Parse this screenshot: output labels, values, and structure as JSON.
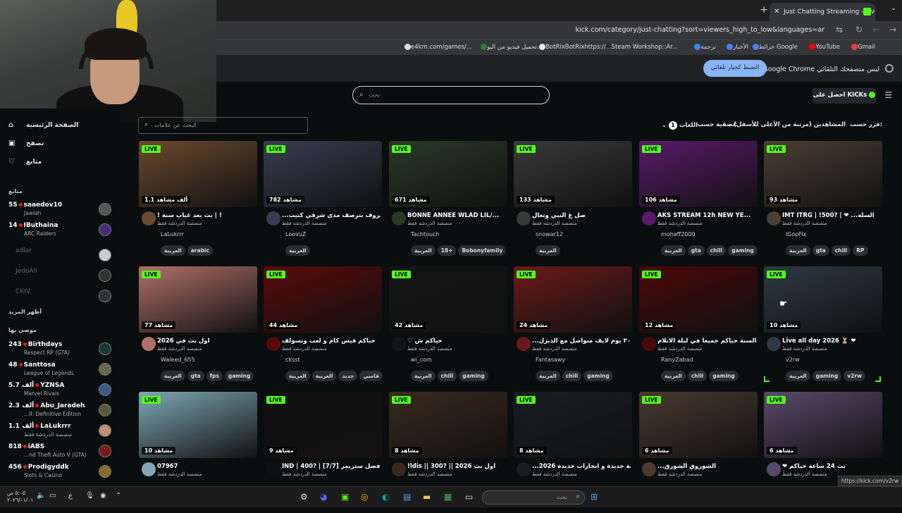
{
  "browser": {
    "tab_title": "Just Chatting Streaming - Live",
    "url": "kick.com/category/just-chatting?sort=viewers_high_to_low&languages=ar",
    "bookmarks": [
      "Gmail",
      "YouTube",
      "خرائط Google",
      "الأخبار",
      "ترجمة",
      "Steam Workshop::Ar...",
      "BotRixBotRixhttps://...",
      "تحميل فيديو من اليو...",
      "e4km.com/games/..."
    ],
    "info_text": "Google Chrome ليس متصفحك التلقائي",
    "info_button": "الضبط كخيار تلقائي"
  },
  "header": {
    "search_placeholder": "بحث",
    "get_kicks": "احصل على KICKs"
  },
  "sidebar": {
    "nav": [
      {
        "label": "الصفحة الرئيسية",
        "icon": "home-icon"
      },
      {
        "label": "تصفح",
        "icon": "browse-icon"
      },
      {
        "label": "متابع",
        "icon": "heart-icon"
      }
    ],
    "following_heading": "متابع",
    "following": [
      {
        "viewers": "55",
        "name": "saaedov10",
        "sub": "Jawlah",
        "live": true
      },
      {
        "viewers": "14",
        "name": "IButhaina",
        "sub": "ARC Raiders",
        "live": true
      },
      {
        "viewers": "",
        "name": "adlar",
        "sub": "",
        "live": false
      },
      {
        "viewers": "",
        "name": "JedoAli",
        "sub": "",
        "live": false
      },
      {
        "viewers": "",
        "name": "CKIV",
        "sub": "",
        "live": false
      }
    ],
    "show_more": "أظهر المزيد",
    "recommended_heading": "موصى بها",
    "recommended": [
      {
        "viewers": "243",
        "name": "Birthdays",
        "sub": "Respect RP (GTA)"
      },
      {
        "viewers": "48",
        "name": "Santtosa",
        "sub": "League of Legends"
      },
      {
        "viewers": "5.7 ألف",
        "name": "YZNSA",
        "sub": "Marvel Rivals"
      },
      {
        "viewers": "2.3 ألف",
        "name": "Abu_Jaradeh",
        "sub": "...II: Definitive Edition"
      },
      {
        "viewers": "1.1 ألف",
        "name": "LaLukrrr",
        "sub": "منصصة الدردشة فقط"
      },
      {
        "viewers": "818",
        "name": "iABS",
        "sub": "...nd Theft Auto V (GTA)"
      },
      {
        "viewers": "456",
        "name": "Prodigyddk",
        "sub": "Slots & Casino"
      }
    ]
  },
  "filters": {
    "search_placeholder": "البحث عن علامات",
    "sort_label": "فرز حسب:",
    "sort_value": "المشاهدين (مرتبة من الأعلى للأسفل)",
    "filter_label": "تصفية حسب:",
    "languages_label": "اللغات",
    "languages_count": "1"
  },
  "streams": [
    {
      "viewers": "1.1 ألف مشاهد",
      "title": "! بث بعد غياب سنة | !",
      "category": "منصصة الدردشة فقط",
      "user": "LaLukrrr",
      "tags": [
        "العربية",
        "arabic"
      ],
      "color": "#6b4a2e"
    },
    {
      "viewers": "782 مشاهد",
      "title": "...ام الحروف بترصف مدى شرقي كنيت",
      "category": "منصصة الدردشة فقط",
      "user": "LoovuZ",
      "tags": [
        "العربية"
      ],
      "color": "#3a3d52"
    },
    {
      "viewers": "671 مشاهد",
      "title": "BONNE ANNEE WLAD LIL/...",
      "category": "منصصة الدردشة فقط",
      "user": "Tachtouch",
      "tags": [
        "العربية",
        "18+",
        "Bobonyfamily"
      ],
      "color": "#2a3a28"
    },
    {
      "viewers": "133 مشاهد",
      "title": "صل ع النبي وتعال",
      "category": "منصصة الدردشة فقط",
      "user": "snowar12",
      "tags": [
        "العربية"
      ],
      "color": "#3a3a3a"
    },
    {
      "viewers": "106 مشاهد",
      "title": "AKS STREAM 12h NEW YE...",
      "category": "منصصة الدردشة فقط",
      "user": "mohaff2000",
      "tags": [
        "العربية",
        "gta",
        "chill",
        "gaming"
      ],
      "color": "#5a1a6a"
    },
    {
      "viewers": "93 مشاهد",
      "title": "IMT ITRG | !500? | ❤ ...السلة",
      "category": "منصصة الدردشة فقط",
      "user": "IGopFix",
      "tags": [
        "العربية",
        "gta",
        "chill",
        "RP"
      ],
      "color": "#4a4034"
    },
    {
      "viewers": "77 مشاهد",
      "title": "اول بث في 2026",
      "category": "منصصة الدردشة فقط",
      "user": "Waleed_655",
      "tags": [
        "العربية",
        "gta",
        "fps",
        "gaming"
      ],
      "color": "#b0706a"
    },
    {
      "viewers": "44 مشاهد",
      "title": "حياكم قيس كام و لعب وتسولف",
      "category": "منصصة الدردشة فقط",
      "user": "cksst",
      "tags": [
        "العربية",
        "العربية",
        "جديد",
        "قاسي"
      ],
      "color": "#5a0a0a"
    },
    {
      "viewers": "42 مشاهد",
      "title": "♡ حياكم ش",
      "category": "منصصة الدردشة فقط",
      "user": "wi_com",
      "tags": [
        "العربية",
        "chill",
        "gaming"
      ],
      "color": "#151515"
    },
    {
      "viewers": "24 مشاهد",
      "title": "...اليوم ٣٠ يوم لايف متواصل مع الديزل",
      "category": "منصصة الدردشة فقط",
      "user": "Fantasawy",
      "tags": [
        "العربية",
        "chill",
        "gaming"
      ],
      "color": "#6a1a1a"
    },
    {
      "viewers": "12 مشاهد",
      "title": "نهاية السنة حياكم جميعا في ليلة الانلام...",
      "category": "منصصة الدردشة فقط",
      "user": "RanyZabad",
      "tags": [
        "العربية",
        "chill",
        "gaming"
      ],
      "color": "#4a0808"
    },
    {
      "viewers": "10 مشاهد",
      "title": "Live all day 2026 ⏳ ❤",
      "category": "منصصة الدردشة فقط",
      "user": "v2rw",
      "tags": [
        "العربية",
        "gaming",
        "v2rw"
      ],
      "color": "#2e3a44"
    },
    {
      "viewers": "10 مشاهد",
      "title": "07967",
      "category": "منصصة الدردشة فقط",
      "user": "",
      "tags": [],
      "color": "#7fa8b4"
    },
    {
      "viewers": "9 مشاهد",
      "title": "IND | 400? | [7/7] أفضل ستريمر",
      "category": "منصصة الدردشة فقط",
      "user": "",
      "tags": [],
      "color": "#101010"
    },
    {
      "viewers": "8 مشاهد",
      "title": "!ldis || 300? || 2026 اول بث",
      "category": "منصصة الدردشة فقط",
      "user": "",
      "tags": [],
      "color": "#3a2a1e"
    },
    {
      "viewers": "8 مشاهد",
      "title": "...سنة جديدة و انجازات جديدة 2026",
      "category": "منصصة الدردشة فقط",
      "user": "",
      "tags": [],
      "color": "#1a1e22"
    },
    {
      "viewers": "6 مشاهد",
      "title": "...الشوروق الشورق",
      "category": "منصصة الدردشة فقط",
      "user": "",
      "tags": [],
      "color": "#4a3a30"
    },
    {
      "viewers": "6 مشاهد",
      "title": "❤ بث 24 ساعة حياكم",
      "category": "منصصة الدردشة فقط",
      "user": "",
      "tags": [],
      "color": "#5a4a6a"
    }
  ],
  "live_label": "LIVE",
  "status_url": "https://kick.com/v2rw",
  "taskbar": {
    "search_placeholder": "بحث",
    "time": "٥:٠٥ ص",
    "date": "٢٠٢٦/٠١/٠١",
    "lang": "ع"
  }
}
